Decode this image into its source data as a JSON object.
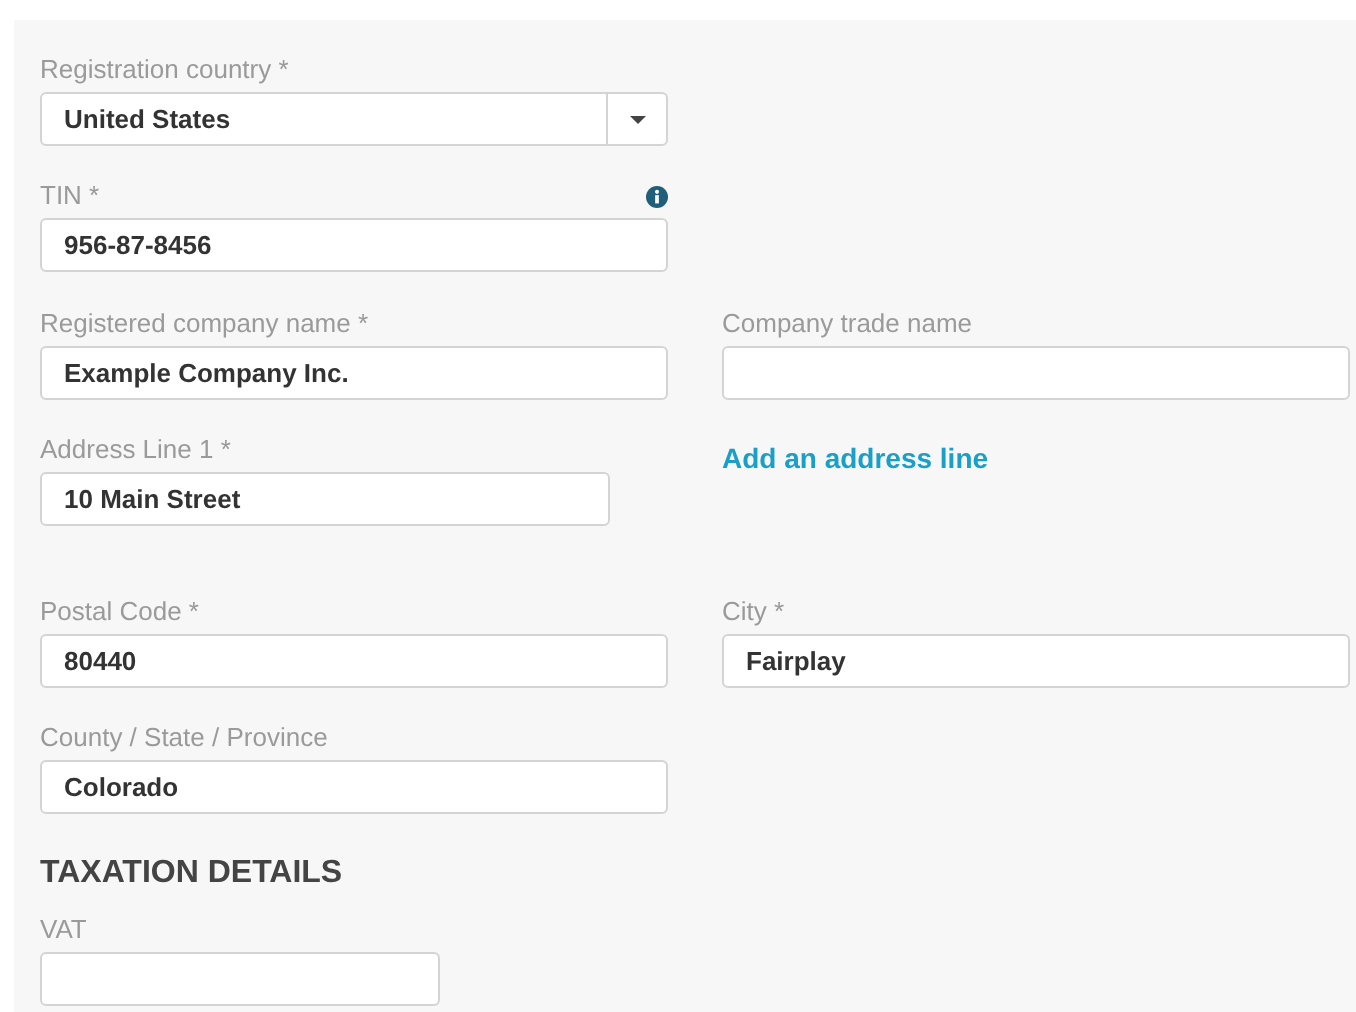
{
  "registration_country": {
    "label": "Registration country *",
    "value": "United States"
  },
  "tin": {
    "label": "TIN *",
    "value": "956-87-8456"
  },
  "registered_company_name": {
    "label": "Registered company name *",
    "value": "Example Company Inc."
  },
  "company_trade_name": {
    "label": "Company trade name"
  },
  "address_line_1": {
    "label": "Address Line 1 *",
    "value": "10 Main Street"
  },
  "add_address_line": "Add an address line",
  "postal_code": {
    "label": "Postal Code *",
    "value": "80440"
  },
  "city": {
    "label": "City *",
    "value": "Fairplay"
  },
  "county_state_province": {
    "label": "County / State / Province",
    "value": "Colorado"
  },
  "taxation_details": {
    "heading": "TAXATION DETAILS",
    "vat": {
      "label": "VAT"
    }
  }
}
